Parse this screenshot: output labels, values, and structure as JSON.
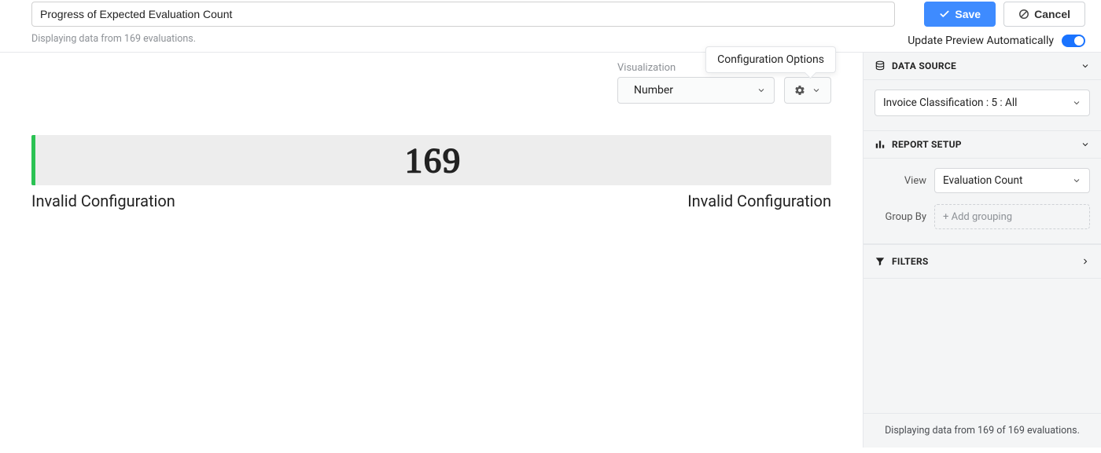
{
  "header": {
    "title_value": "Progress of Expected Evaluation Count",
    "sub_text": "Displaying data from 169 evaluations.",
    "save_label": "Save",
    "cancel_label": "Cancel",
    "auto_preview_label": "Update Preview Automatically"
  },
  "tooltip": {
    "config_options": "Configuration Options"
  },
  "visualization": {
    "label": "Visualization",
    "selected": "Number"
  },
  "preview": {
    "big_number": "169",
    "left_msg": "Invalid Configuration",
    "right_msg": "Invalid Configuration"
  },
  "sidebar": {
    "data_source": {
      "title": "DATA SOURCE",
      "selected": "Invoice Classification : 5 : All"
    },
    "report_setup": {
      "title": "REPORT SETUP",
      "view_label": "View",
      "view_selected": "Evaluation Count",
      "groupby_label": "Group By",
      "groupby_placeholder": "+ Add grouping"
    },
    "filters": {
      "title": "FILTERS"
    },
    "footer": "Displaying data from 169 of 169 evaluations."
  }
}
